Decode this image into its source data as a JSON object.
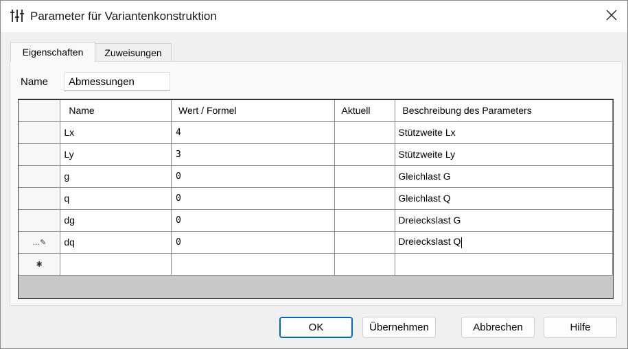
{
  "window": {
    "title": "Parameter für Variantenkonstruktion"
  },
  "tabs": [
    {
      "label": "Eigenschaften",
      "active": true
    },
    {
      "label": "Zuweisungen",
      "active": false
    }
  ],
  "name_field": {
    "label": "Name",
    "value": "Abmessungen"
  },
  "grid": {
    "columns": [
      "Name",
      "Wert / Formel",
      "Aktuell",
      "Beschreibung des Parameters"
    ],
    "rows": [
      {
        "name": "Lx",
        "wert": "4",
        "aktuell": "",
        "beschreibung": "Stützweite Lx"
      },
      {
        "name": "Ly",
        "wert": "3",
        "aktuell": "",
        "beschreibung": "Stützweite Ly"
      },
      {
        "name": "g",
        "wert": "0",
        "aktuell": "",
        "beschreibung": "Gleichlast G"
      },
      {
        "name": "q",
        "wert": "0",
        "aktuell": "",
        "beschreibung": "Gleichlast Q"
      },
      {
        "name": "dg",
        "wert": "0",
        "aktuell": "",
        "beschreibung": "Dreieckslast G"
      },
      {
        "name": "dq",
        "wert": "0",
        "aktuell": "",
        "beschreibung": "Dreieckslast Q"
      }
    ],
    "edit_row_marker": "…✎",
    "new_row_marker": "✱"
  },
  "buttons": {
    "ok": "OK",
    "apply": "Übernehmen",
    "cancel": "Abbrechen",
    "help": "Hilfe"
  },
  "icons": {
    "app": "sliders-icon",
    "close": "close-icon"
  }
}
